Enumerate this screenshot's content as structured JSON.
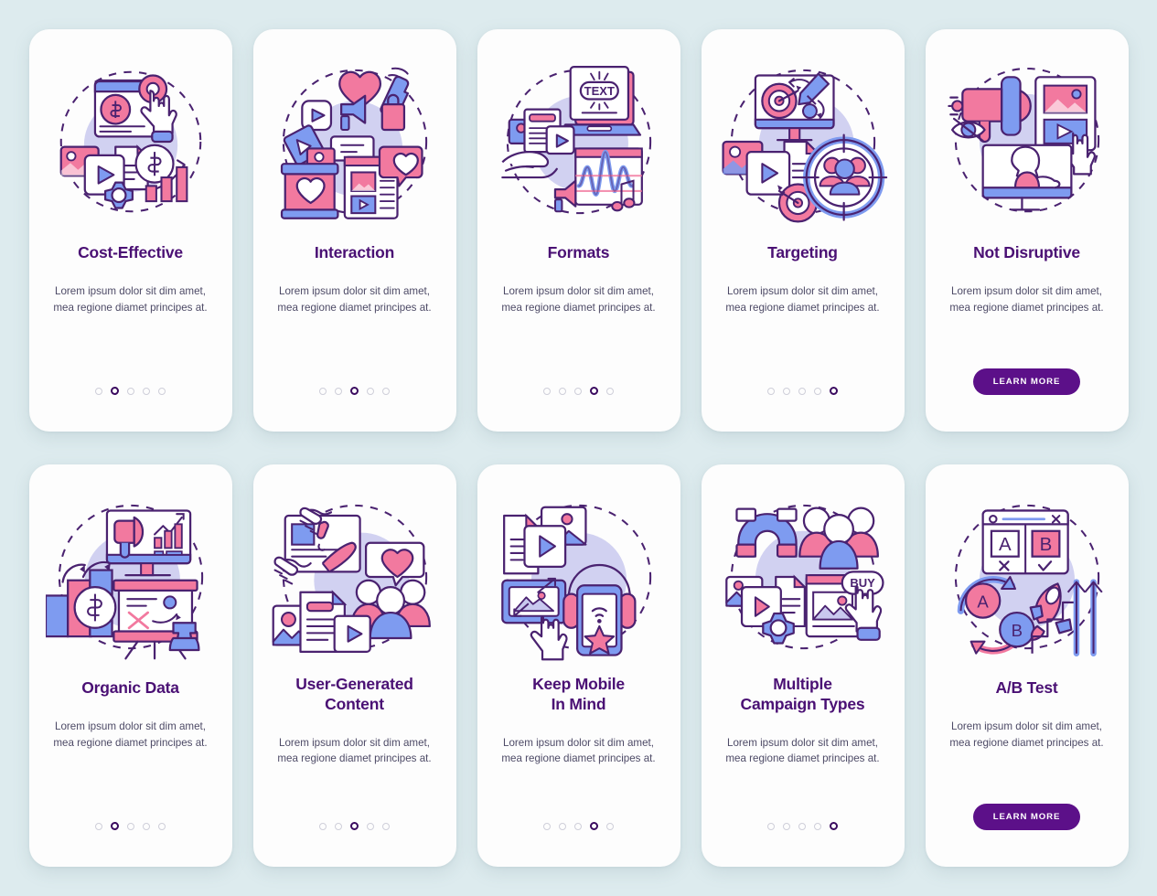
{
  "page": {
    "background_color": "#ddebee",
    "card_background": "#fdfdfd",
    "title_color": "#4a1074",
    "body_color": "#4d4a66",
    "accent_pink": "#f2799f",
    "accent_blue": "#7e9bf0",
    "accent_lavender": "#c6c6f0",
    "outline_color": "#4a2270",
    "dot_active_color": "#3a0a5f",
    "dot_inactive_color": "#cfcfd9",
    "cta_color": "#5c1089"
  },
  "shared": {
    "body_text": "Lorem ipsum dolor sit dim amet, mea regione diamet principes at.",
    "cta_label": "LEARN MORE",
    "dot_count": 5
  },
  "cards": [
    {
      "id": "cost-effective",
      "title": "Cost-Effective",
      "body": "Lorem ipsum dolor sit dim amet, mea regione diamet principes at.",
      "active_dot": 1,
      "has_cta": false,
      "cta_label": "",
      "illustration": "cost-effective-illustration",
      "icon_elements": [
        "browser-window",
        "dollar-coin",
        "pointer-hand",
        "video-card",
        "document",
        "gear",
        "bar-chart",
        "growth-arrow"
      ]
    },
    {
      "id": "interaction",
      "title": "Interaction",
      "body": "Lorem ipsum dolor sit dim amet, mea regione diamet principes at.",
      "active_dot": 2,
      "has_cta": false,
      "cta_label": "",
      "illustration": "interaction-illustration",
      "icon_elements": [
        "heart",
        "phone-call",
        "play-button",
        "megaphone",
        "shopping-bag",
        "chat-bubble",
        "post-card",
        "like-bubble"
      ]
    },
    {
      "id": "formats",
      "title": "Formats",
      "body": "Lorem ipsum dolor sit dim amet, mea regione diamet principes at.",
      "active_dot": 3,
      "has_cta": false,
      "cta_label": "",
      "illustration": "formats-illustration",
      "icon_elements": [
        "laptop-text-screen",
        "text-label",
        "document-card",
        "play-button",
        "hand",
        "audio-waveform",
        "megaphone",
        "music-note"
      ]
    },
    {
      "id": "targeting",
      "title": "Targeting",
      "body": "Lorem ipsum dolor sit dim amet, mea regione diamet principes at.",
      "active_dot": 4,
      "has_cta": false,
      "cta_label": "",
      "illustration": "targeting-illustration",
      "icon_elements": [
        "monitor",
        "target-dartboard",
        "pencil",
        "image-card",
        "video-card",
        "document",
        "crosshair-people"
      ]
    },
    {
      "id": "not-disruptive",
      "title": "Not Disruptive",
      "body": "Lorem ipsum dolor sit dim amet, mea regione diamet principes at.",
      "active_dot": 0,
      "has_cta": true,
      "cta_label": "LEARN MORE",
      "illustration": "not-disruptive-illustration",
      "icon_elements": [
        "megaphone",
        "eye-off",
        "image-tile",
        "video-tile",
        "pointer-hand",
        "monitor-presenter"
      ]
    },
    {
      "id": "organic-data",
      "title": "Organic Data",
      "body": "Lorem ipsum dolor sit dim amet, mea regione diamet principes at.",
      "active_dot": 1,
      "has_cta": false,
      "cta_label": "",
      "illustration": "organic-data-illustration",
      "icon_elements": [
        "monitor-chart",
        "megaphone",
        "bar-chart",
        "dollar-coin",
        "whiteboard",
        "chess-rook",
        "curved-arrow"
      ]
    },
    {
      "id": "user-generated-content",
      "title": "User-Generated Content",
      "title_lines": [
        "User-Generated",
        "Content"
      ],
      "body": "Lorem ipsum dolor sit dim amet, mea regione diamet principes at.",
      "active_dot": 2,
      "has_cta": false,
      "cta_label": "",
      "illustration": "user-generated-content-illustration",
      "icon_elements": [
        "hands-writing",
        "pen",
        "heart-bubble",
        "people-group",
        "document",
        "video-card",
        "image-card"
      ]
    },
    {
      "id": "keep-mobile-in-mind",
      "title": "Keep Mobile In Mind",
      "title_lines": [
        "Keep Mobile",
        "In Mind"
      ],
      "body": "Lorem ipsum dolor sit dim amet, mea regione diamet principes at.",
      "active_dot": 3,
      "has_cta": false,
      "cta_label": "",
      "illustration": "keep-mobile-in-mind-illustration",
      "icon_elements": [
        "document",
        "video-card",
        "image-card",
        "responsive-resize",
        "pointer-hand",
        "headphones",
        "smartphone",
        "star",
        "wifi"
      ]
    },
    {
      "id": "multiple-campaign-types",
      "title": "Multiple Campaign Types",
      "title_lines": [
        "Multiple",
        "Campaign Types"
      ],
      "body": "Lorem ipsum dolor sit dim amet, mea regione diamet principes at.",
      "active_dot": 4,
      "has_cta": false,
      "cta_label": "",
      "illustration": "multiple-campaign-types-illustration",
      "icon_elements": [
        "magnet",
        "people-group",
        "image-card",
        "video-card",
        "document",
        "gear",
        "buy-tag",
        "pointer-hand"
      ]
    },
    {
      "id": "ab-test",
      "title": "A/B Test",
      "body": "Lorem ipsum dolor sit dim amet, mea regione diamet principes at.",
      "active_dot": 0,
      "has_cta": true,
      "cta_label": "LEARN MORE",
      "illustration": "ab-test-illustration",
      "icon_elements": [
        "browser-window",
        "variant-a",
        "variant-b",
        "cross-mark",
        "check-mark",
        "circular-arrows",
        "rocket",
        "up-arrow",
        "stairs"
      ]
    }
  ]
}
